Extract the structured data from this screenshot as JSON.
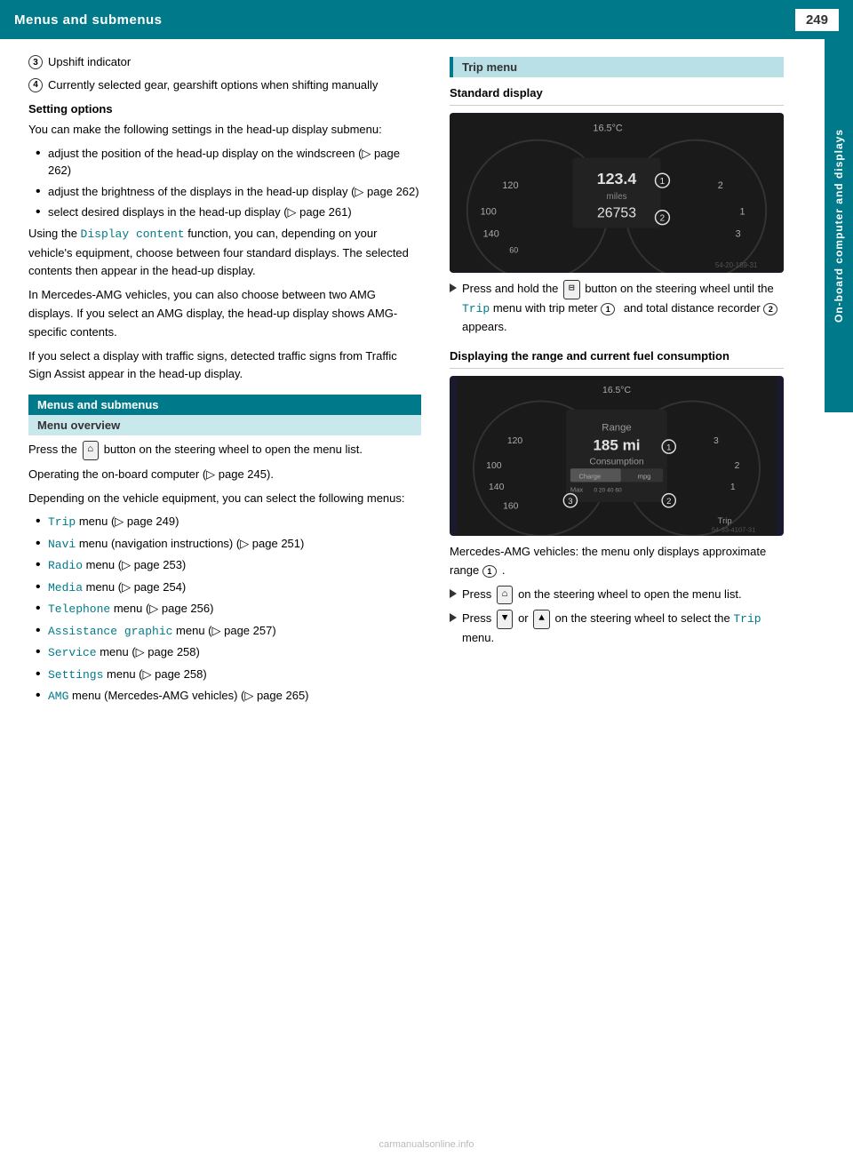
{
  "header": {
    "title": "Menus and submenus",
    "page_number": "249"
  },
  "side_tab": {
    "label": "On-board computer and displays"
  },
  "numbered_items": [
    {
      "num": "3",
      "text": "Upshift indicator"
    },
    {
      "num": "4",
      "text": "Currently selected gear, gearshift options when shifting manually"
    }
  ],
  "setting_options": {
    "heading": "Setting options",
    "intro": "You can make the following settings in the head-up display submenu:",
    "bullets": [
      "adjust the position of the head-up display on the windscreen (▷ page 262)",
      "adjust the brightness of the displays in the head-up display (▷ page 262)",
      "select desired displays in the head-up display (▷ page 261)"
    ],
    "display_content_para1": "Using the Display content function, you can, depending on your vehicle's equipment, choose between four standard displays. The selected contents then appear in the head-up display.",
    "display_content_para2": "In Mercedes-AMG vehicles, you can also choose between two AMG displays. If you select an AMG display, the head-up display shows AMG-specific contents.",
    "display_content_para3": "If you select a display with traffic signs, detected traffic signs from Traffic Sign Assist appear in the head-up display."
  },
  "menus_submenus": {
    "section_label": "Menus and submenus",
    "menu_overview_label": "Menu overview",
    "press_button_text": "Press the",
    "press_button_desc": "button on the steering wheel to open the menu list.",
    "operating_text": "Operating the on-board computer (▷ page 245).",
    "depending_text": "Depending on the vehicle equipment, you can select the following menus:",
    "menu_items": [
      {
        "code": "Trip",
        "text": "menu (▷ page 249)"
      },
      {
        "code": "Navi",
        "text": "menu (navigation instructions) (▷ page 251)"
      },
      {
        "code": "Radio",
        "text": "menu (▷ page 253)"
      },
      {
        "code": "Media",
        "text": "menu (▷ page 254)"
      },
      {
        "code": "Telephone",
        "text": "menu (▷ page 256)"
      },
      {
        "code": "Assistance graphic",
        "text": "menu (▷ page 257)"
      },
      {
        "code": "Service",
        "text": "menu (▷ page 258)"
      },
      {
        "code": "Settings",
        "text": "menu (▷ page 258)"
      },
      {
        "code": "AMG",
        "text": "menu (Mercedes-AMG vehicles) (▷ page 265)"
      }
    ]
  },
  "trip_menu": {
    "section_label": "Trip menu",
    "standard_display_label": "Standard display",
    "instrument_temp1": "16.5°C",
    "instrument_reading1": "123.4",
    "instrument_unit1": "miles",
    "instrument_reading2": "26753",
    "press_hold_text": "Press and hold the",
    "press_hold_button": "⊟",
    "press_hold_desc": "button on the steering wheel until the Trip menu with trip meter",
    "circle1": "1",
    "and_text": "and total distance recorder",
    "circle2": "2",
    "appears_text": "appears.",
    "fuel_section": "Displaying the range and current fuel consumption",
    "instrument_temp2": "16.5°C",
    "instrument_range": "Range",
    "instrument_range_val": "185 mi",
    "instrument_consumption": "Consumption",
    "circle_fuel": "1",
    "circle_trip": "2",
    "circle_charge": "3",
    "amg_note": "Mercedes-AMG vehicles: the menu only displays approximate range",
    "circle_amg": "1",
    "amg_period": ".",
    "press_open_text": "Press",
    "press_open_btn": "⌂",
    "press_open_desc": "on the steering wheel to open the menu list.",
    "press_select_text": "Press",
    "press_down_btn": "▼",
    "press_or": "or",
    "press_up_btn": "▲",
    "press_select_desc": "on the steering wheel to select the",
    "trip_code": "Trip",
    "trip_menu_period": "menu."
  },
  "footer": {
    "watermark": "carmanualsonline.info"
  }
}
